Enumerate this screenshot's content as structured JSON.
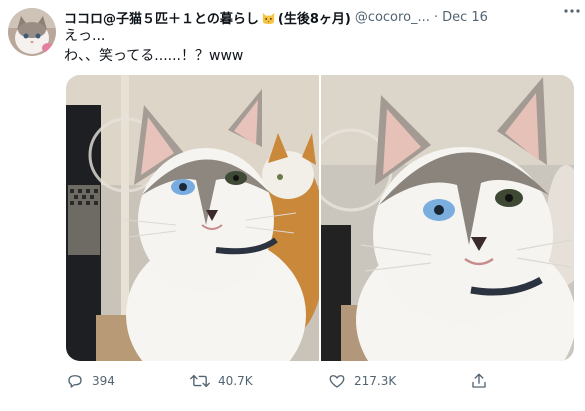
{
  "tweet": {
    "display_name": "ココロ@子猫５匹＋１との暮らし",
    "display_name_suffix": "(生後8ヶ月)",
    "handle": "@cocoro_...",
    "separator": "·",
    "date": "Dec 16",
    "text_line1": "えっ...",
    "text_line2": "わ、、笑ってる......！？www"
  },
  "actions": {
    "replies": "394",
    "retweets": "40.7K",
    "likes": "217.3K"
  },
  "icons": [
    "avatar-cat",
    "cat-emoji-icon",
    "more-icon",
    "reply-icon",
    "retweet-icon",
    "like-icon",
    "share-icon"
  ],
  "colors": {
    "secondary_text": "#536471",
    "primary_text": "#0f1419"
  }
}
